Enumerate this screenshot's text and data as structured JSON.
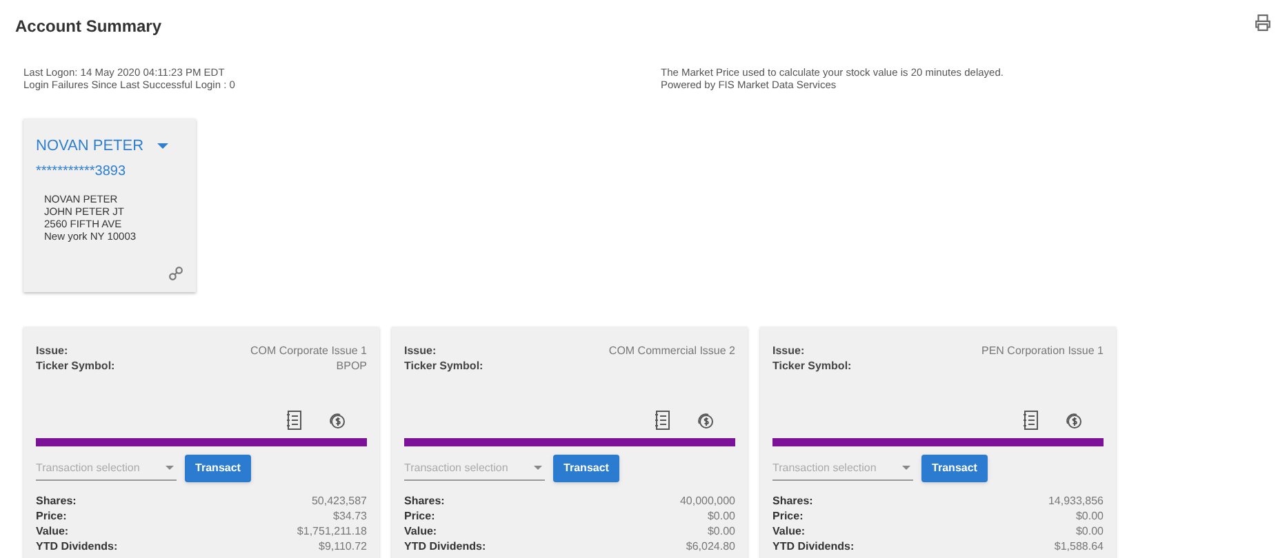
{
  "page_title": "Account Summary",
  "login_info": [
    "Last Logon: 14 May 2020 04:11:23 PM EDT",
    "Login Failures Since Last Successful Login : 0"
  ],
  "market_notice": [
    "The Market Price used to calculate your stock value is 20 minutes delayed.",
    "Powered by FIS Market Data Services"
  ],
  "account": {
    "name": "NOVAN PETER",
    "number": "***********3893",
    "address": [
      "NOVAN PETER",
      "JOHN PETER JT",
      "2560 FIFTH AVE",
      "New york NY 10003"
    ]
  },
  "holdings": [
    {
      "fields": [
        {
          "label": "Issue:",
          "value": "COM Corporate Issue 1"
        },
        {
          "label": "Ticker Symbol:",
          "value": "BPOP"
        }
      ],
      "transaction_placeholder": "Transaction selection",
      "button": "Transact",
      "stats": [
        {
          "label": "Shares:",
          "value": "50,423,587"
        },
        {
          "label": "Price:",
          "value": "$34.73"
        },
        {
          "label": "Value:",
          "value": "$1,751,211.18"
        },
        {
          "label": "YTD Dividends:",
          "value": "$9,110.72"
        }
      ]
    },
    {
      "fields": [
        {
          "label": "Issue:",
          "value": "COM Commercial Issue 2"
        },
        {
          "label": "Ticker Symbol:"
        }
      ],
      "transaction_placeholder": "Transaction selection",
      "button": "Transact",
      "stats": [
        {
          "label": "Shares:",
          "value": "40,000,000"
        },
        {
          "label": "Price:",
          "value": "$0.00"
        },
        {
          "label": "Value:",
          "value": "$0.00"
        },
        {
          "label": "YTD Dividends:",
          "value": "$6,024.80"
        }
      ]
    },
    {
      "fields": [
        {
          "label": "Issue:",
          "value": "PEN Corporation Issue 1"
        },
        {
          "label": "Ticker Symbol:"
        }
      ],
      "transaction_placeholder": "Transaction selection",
      "button": "Transact",
      "stats": [
        {
          "label": "Shares:",
          "value": "14,933,856"
        },
        {
          "label": "Price:",
          "value": "$0.00"
        },
        {
          "label": "Value:",
          "value": "$0.00"
        },
        {
          "label": "YTD Dividends:",
          "value": "$1,588.64"
        }
      ]
    }
  ]
}
